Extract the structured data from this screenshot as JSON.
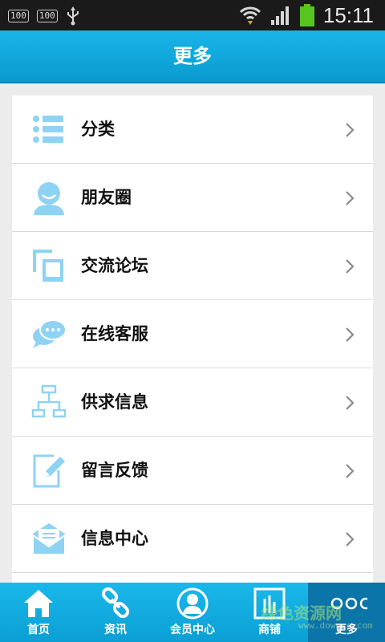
{
  "status_bar": {
    "badge1": "100",
    "badge2": "100",
    "time": "15:11"
  },
  "header": {
    "title": "更多"
  },
  "menu": {
    "items": [
      {
        "label": "分类",
        "icon": "list-icon"
      },
      {
        "label": "朋友圈",
        "icon": "person-icon"
      },
      {
        "label": "交流论坛",
        "icon": "forum-icon"
      },
      {
        "label": "在线客服",
        "icon": "chat-bubble-icon"
      },
      {
        "label": "供求信息",
        "icon": "org-chart-icon"
      },
      {
        "label": "留言反馈",
        "icon": "edit-icon"
      },
      {
        "label": "信息中心",
        "icon": "mail-icon"
      }
    ]
  },
  "bottom_nav": {
    "items": [
      {
        "label": "首页",
        "icon": "home-icon"
      },
      {
        "label": "资讯",
        "icon": "link-icon"
      },
      {
        "label": "会员中心",
        "icon": "member-icon"
      },
      {
        "label": "商铺",
        "icon": "shop-icon"
      },
      {
        "label": "更多",
        "icon": "more-icon"
      }
    ],
    "active_index": 4
  },
  "watermark": {
    "text": "绿色资源网",
    "sub": "www.downcc.com"
  },
  "colors": {
    "accent": "#0ea7dc",
    "icon_blue": "#8fd3f4",
    "active_nav": "#0b74a8"
  }
}
